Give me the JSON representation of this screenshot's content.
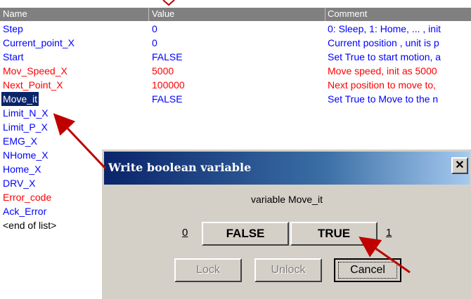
{
  "columns": {
    "name": "Name",
    "value": "Value",
    "comment": "Comment"
  },
  "rows": [
    {
      "name": "Step",
      "value": "0",
      "comment": "0: Sleep, 1: Home, ... , init",
      "color": "#0000ff"
    },
    {
      "name": "Current_point_X",
      "value": "0",
      "comment": "Current position , unit is p",
      "color": "#0000ff"
    },
    {
      "name": "Start",
      "value": "FALSE",
      "comment": "Set True to start motion, a",
      "color": "#0000ff"
    },
    {
      "name": "Mov_Speed_X",
      "value": "5000",
      "comment": "Move speed, init as 5000",
      "color": "#ff0000"
    },
    {
      "name": "Next_Point_X",
      "value": "100000",
      "comment": "Next position to move to,",
      "color": "#ff0000"
    },
    {
      "name": "Move_it",
      "value": "FALSE",
      "comment": "Set True to Move to the n",
      "color": "#0000ff",
      "selected": true
    },
    {
      "name": "Limit_N_X",
      "value": "",
      "comment": "",
      "color": "#0000ff"
    },
    {
      "name": "Limit_P_X",
      "value": "",
      "comment": "",
      "color": "#0000ff"
    },
    {
      "name": "EMG_X",
      "value": "",
      "comment": "",
      "color": "#0000ff"
    },
    {
      "name": "NHome_X",
      "value": "",
      "comment": "",
      "color": "#0000ff"
    },
    {
      "name": "Home_X",
      "value": "",
      "comment": "",
      "color": "#0000ff"
    },
    {
      "name": "DRV_X",
      "value": "",
      "comment": "",
      "color": "#0000ff"
    },
    {
      "name": "Error_code",
      "value": "",
      "comment": "",
      "color": "#ff0000"
    },
    {
      "name": "Ack_Error",
      "value": "",
      "comment": "",
      "color": "#0000ff"
    },
    {
      "name": "<end of list>",
      "value": "",
      "comment": "",
      "color": "#000000"
    }
  ],
  "dialog": {
    "title": "Write boolean variable",
    "close_icon": "close-icon",
    "variable_label": "variable Move_it",
    "false_value": "0",
    "true_value": "1",
    "false_button": "FALSE",
    "true_button": "TRUE",
    "lock_button": "Lock",
    "unlock_button": "Unlock",
    "cancel_button": "Cancel"
  },
  "annotation_color": "#c00000"
}
